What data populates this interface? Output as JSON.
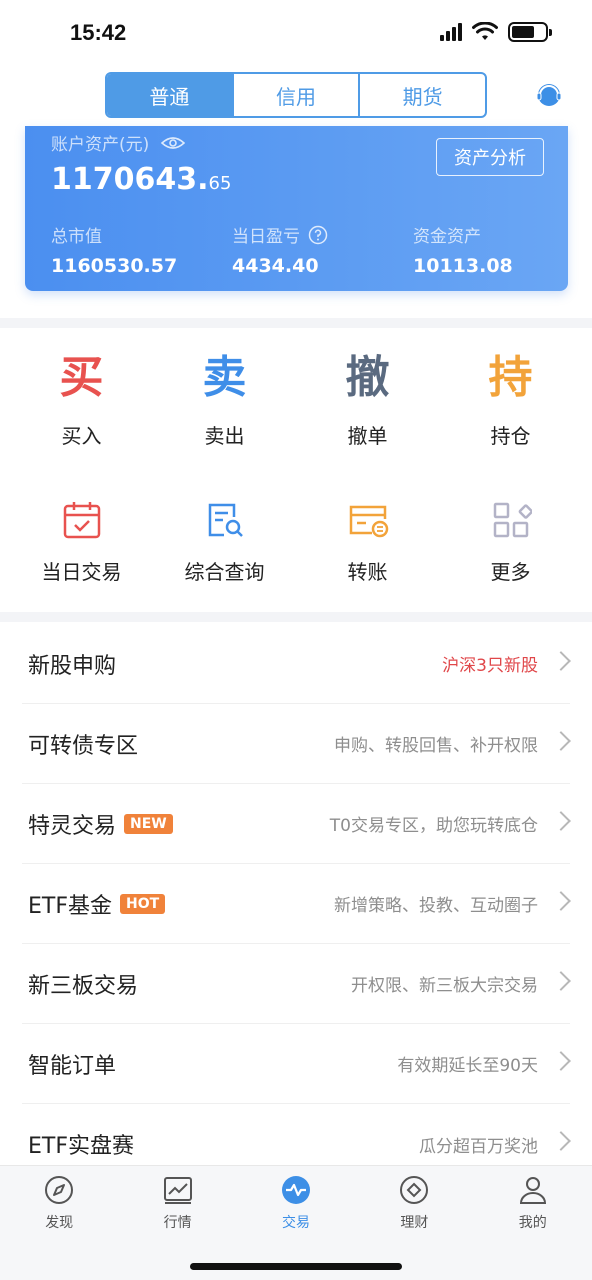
{
  "status": {
    "time": "15:42"
  },
  "tabs": [
    {
      "label": "普通",
      "active": true
    },
    {
      "label": "信用",
      "active": false
    },
    {
      "label": "期货",
      "active": false
    }
  ],
  "account": {
    "label": "账户资产(元)",
    "value_int": "1170643.",
    "value_dec": "65",
    "analysis_label": "资产分析",
    "metrics": [
      {
        "label": "总市值",
        "value": "1160530.57"
      },
      {
        "label": "当日盈亏",
        "value": "4434.40"
      },
      {
        "label": "资金资产",
        "value": "10113.08"
      }
    ]
  },
  "actions_top": [
    {
      "glyph": "买",
      "label": "买入",
      "color": "#e8524f"
    },
    {
      "glyph": "卖",
      "label": "卖出",
      "color": "#3f8ee8"
    },
    {
      "glyph": "撤",
      "label": "撤单",
      "color": "#5a6a80"
    },
    {
      "glyph": "持",
      "label": "持仓",
      "color": "#f2a33a"
    }
  ],
  "actions_bottom": [
    {
      "label": "当日交易",
      "icon": "calendar-icon",
      "color": "#e8524f"
    },
    {
      "label": "综合查询",
      "icon": "document-search-icon",
      "color": "#3f8ee8"
    },
    {
      "label": "转账",
      "icon": "card-transfer-icon",
      "color": "#f2a33a"
    },
    {
      "label": "更多",
      "icon": "grid-more-icon",
      "color": "#b3b3c7"
    }
  ],
  "list": [
    {
      "title": "新股申购",
      "badge": "",
      "desc": "沪深3只新股",
      "desc_red": true
    },
    {
      "title": "可转债专区",
      "badge": "",
      "desc": "申购、转股回售、补开权限",
      "desc_red": false
    },
    {
      "title": "特灵交易",
      "badge": "NEW",
      "desc": "T0交易专区，助您玩转底仓",
      "desc_red": false
    },
    {
      "title": "ETF基金",
      "badge": "HOT",
      "desc": "新增策略、投教、互动圈子",
      "desc_red": false
    },
    {
      "title": "新三板交易",
      "badge": "",
      "desc": "开权限、新三板大宗交易",
      "desc_red": false
    },
    {
      "title": "智能订单",
      "badge": "",
      "desc": "有效期延长至90天",
      "desc_red": false
    },
    {
      "title": "ETF实盘赛",
      "badge": "",
      "desc": "瓜分超百万奖池",
      "desc_red": false
    }
  ],
  "nav": [
    {
      "label": "发现",
      "icon": "compass-icon",
      "active": false
    },
    {
      "label": "行情",
      "icon": "chart-line-icon",
      "active": false
    },
    {
      "label": "交易",
      "icon": "trade-wave-icon",
      "active": true
    },
    {
      "label": "理财",
      "icon": "diamond-icon",
      "active": false
    },
    {
      "label": "我的",
      "icon": "person-icon",
      "active": false
    }
  ]
}
